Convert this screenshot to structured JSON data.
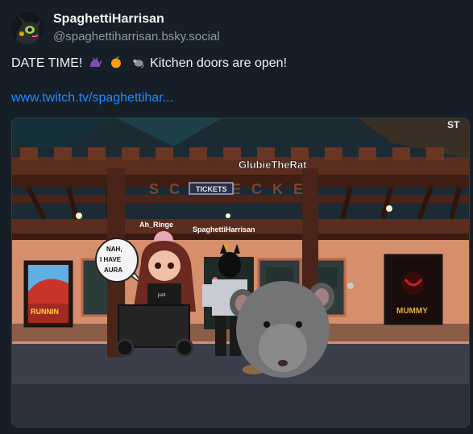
{
  "post": {
    "author": {
      "display_name": "SpaghettiHarrisan",
      "handle": "@spaghettiharrisan.bsky.social",
      "avatar_icon": "black-cat-avatar-icon"
    },
    "text": "DATE TIME!",
    "text_suffix": "Kitchen doors are open!",
    "emojis": [
      "cat-emoji",
      "tangerine-emoji",
      "rat-emoji"
    ],
    "link": "www.twitch.tv/spaghettihar..."
  },
  "scene": {
    "sign": "TICKETS",
    "player_name_rat": "GlubieTheRat",
    "player_name_ah": "Ah_Ringe",
    "player_name_spaghetti": "SpaghettiHarrisan",
    "speech_bubble": [
      "NAH,",
      "I HAVE",
      "AURA"
    ],
    "poster_left": "RUNNIN",
    "poster_right": "MUMMY",
    "shirt_text": "just"
  },
  "colors": {
    "background": "#161e27",
    "text": "#f1f3f5",
    "muted": "#8b98a5",
    "link": "#208bfe"
  }
}
